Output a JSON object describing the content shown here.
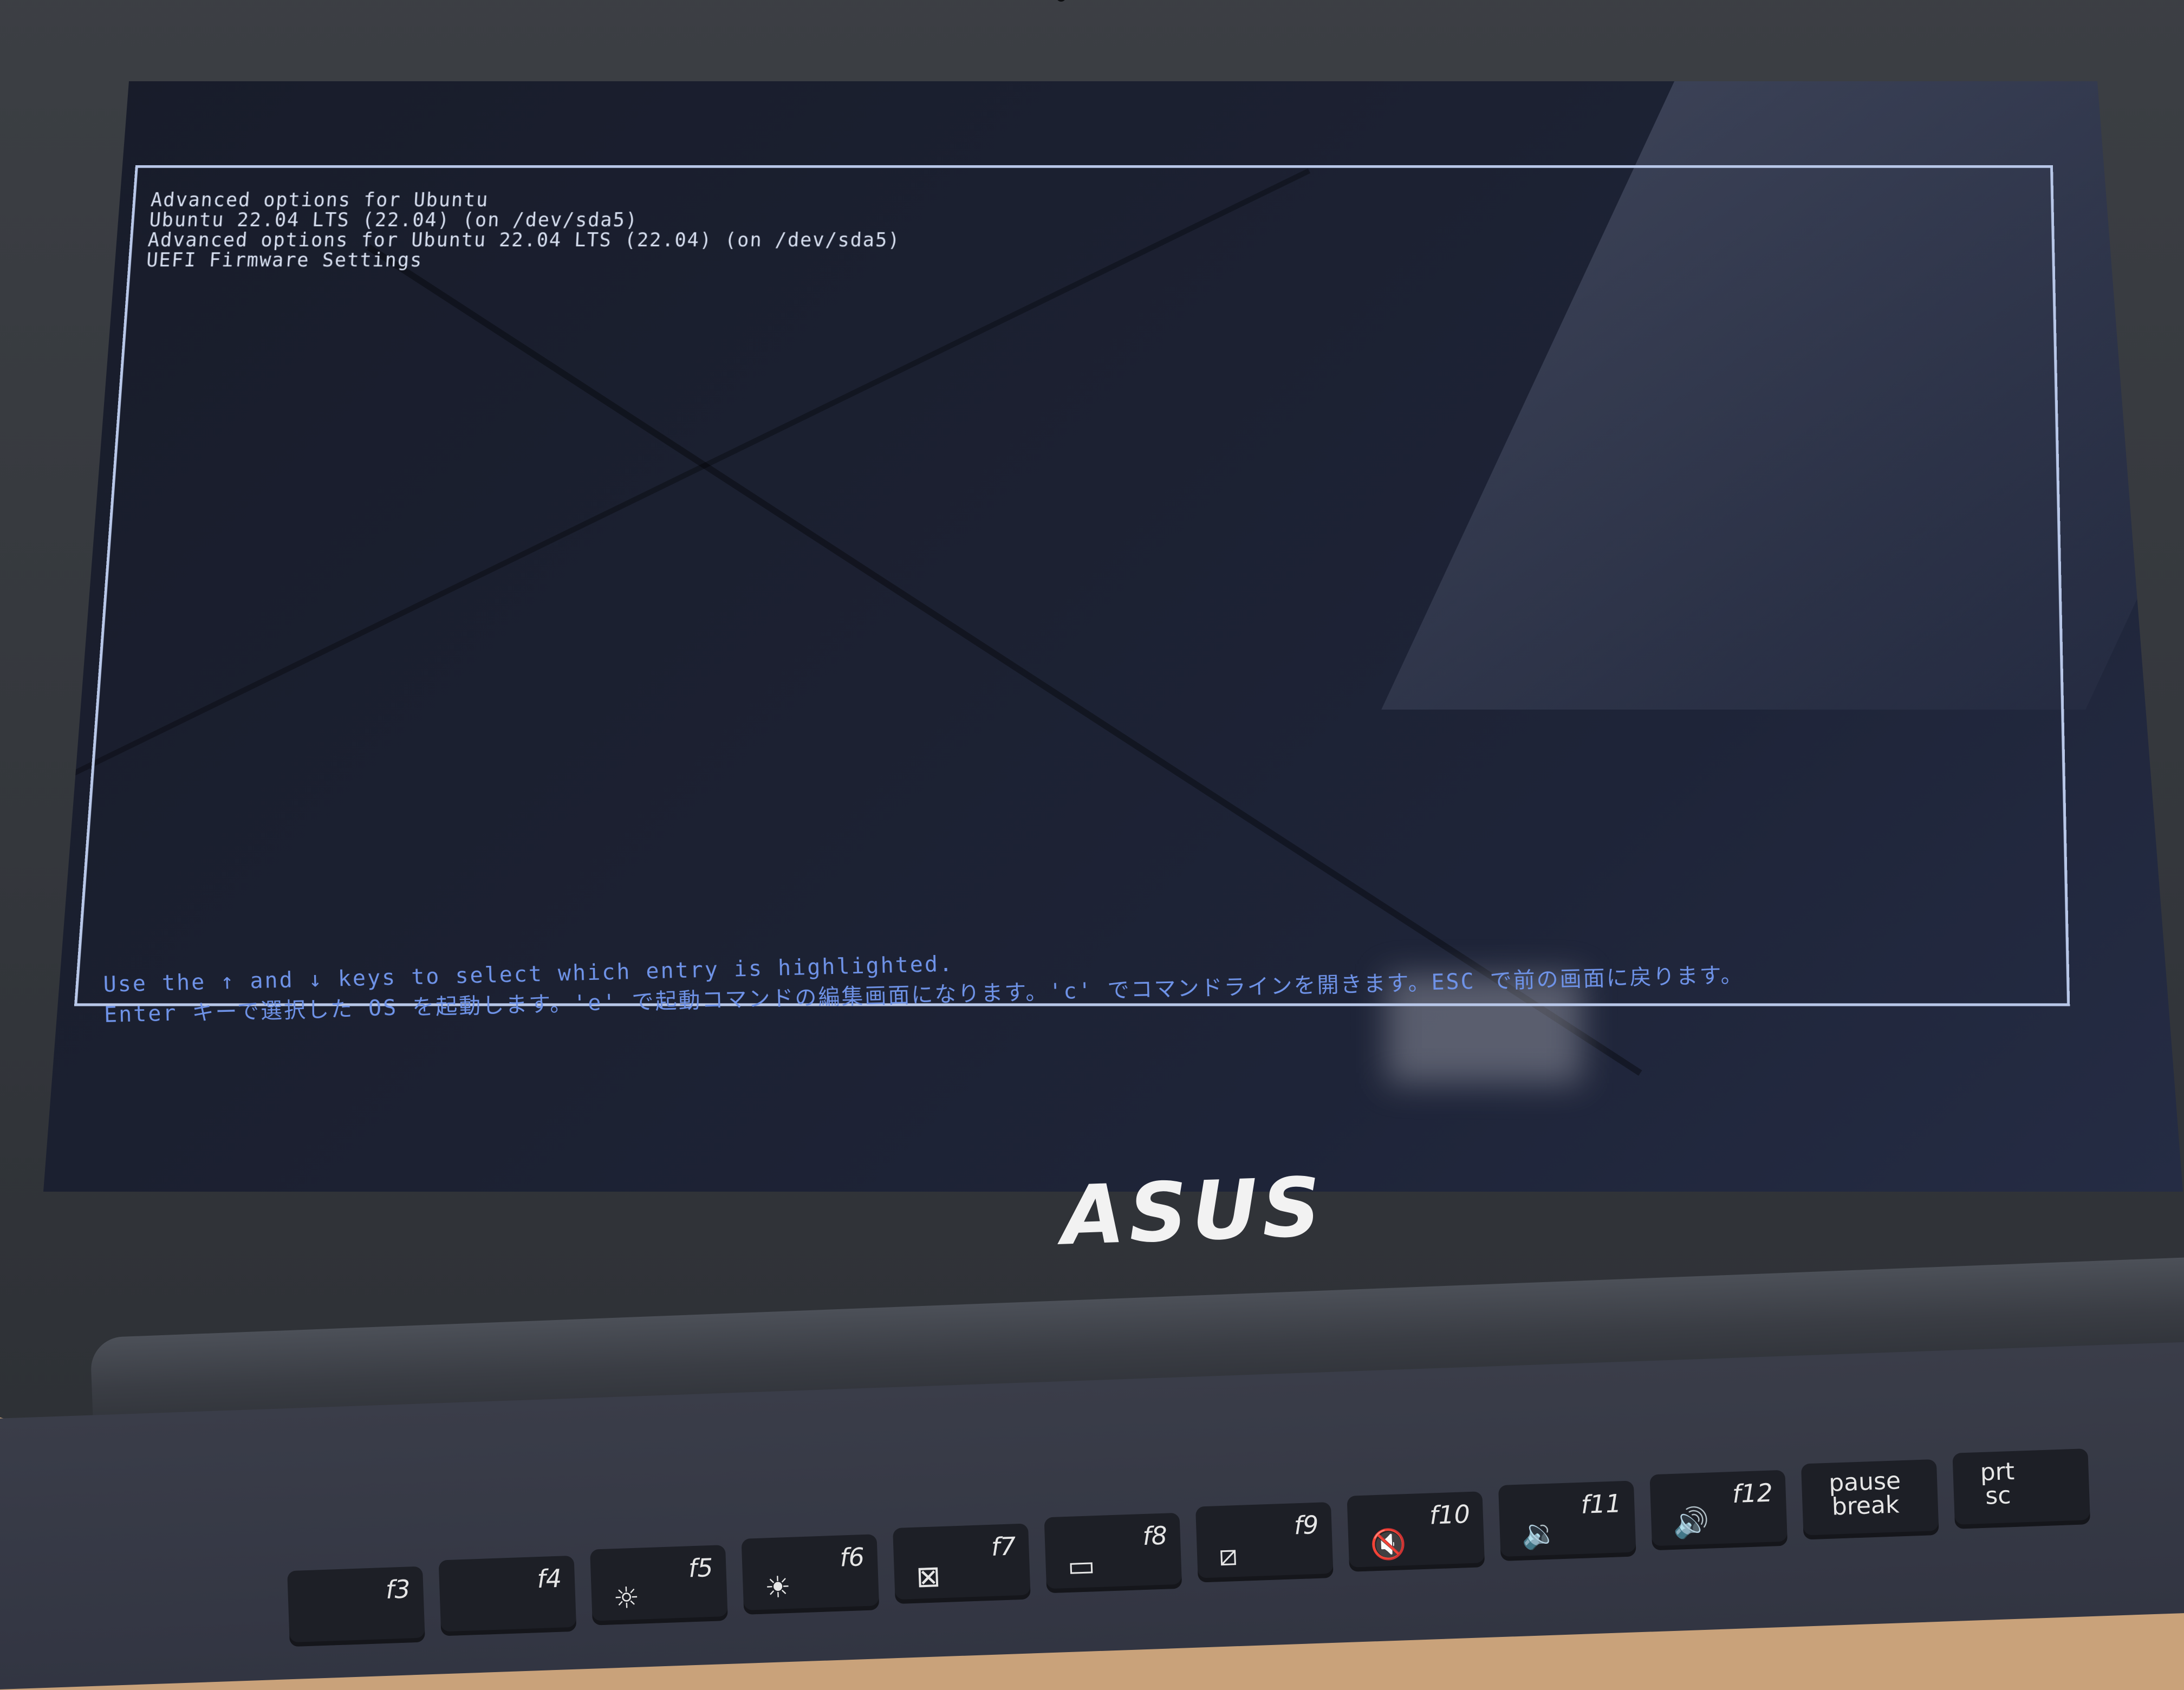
{
  "grub": {
    "menu_items": [
      "Advanced options for Ubuntu",
      "Ubuntu 22.04 LTS (22.04) (on /dev/sda5)",
      "Advanced options for Ubuntu 22.04 LTS (22.04) (on /dev/sda5)",
      "UEFI Firmware Settings"
    ],
    "help_line_1": "Use the ↑ and ↓ keys to select which entry is highlighted.",
    "help_line_2": "Enter キーで選択した OS を起動します。'e' で起動コマンドの編集画面になります。'c' でコマンドラインを開きます。ESC で前の画面に戻ります。"
  },
  "laptop": {
    "brand": "ASUS"
  },
  "keyboard": {
    "function_keys": [
      {
        "label": "f3",
        "icon": "none"
      },
      {
        "label": "f4",
        "icon": "none"
      },
      {
        "label": "f5",
        "icon": "brightness-down-icon"
      },
      {
        "label": "f6",
        "icon": "brightness-up-icon"
      },
      {
        "label": "f7",
        "icon": "display-off-icon"
      },
      {
        "label": "f8",
        "icon": "projector-icon"
      },
      {
        "label": "f9",
        "icon": "touchpad-icon"
      },
      {
        "label": "f10",
        "icon": "mute-icon"
      },
      {
        "label": "f11",
        "icon": "volume-down-icon"
      },
      {
        "label": "f12",
        "icon": "volume-up-icon"
      }
    ],
    "pause_key": "pause\nbreak",
    "prt_key": "prt\nsc"
  }
}
